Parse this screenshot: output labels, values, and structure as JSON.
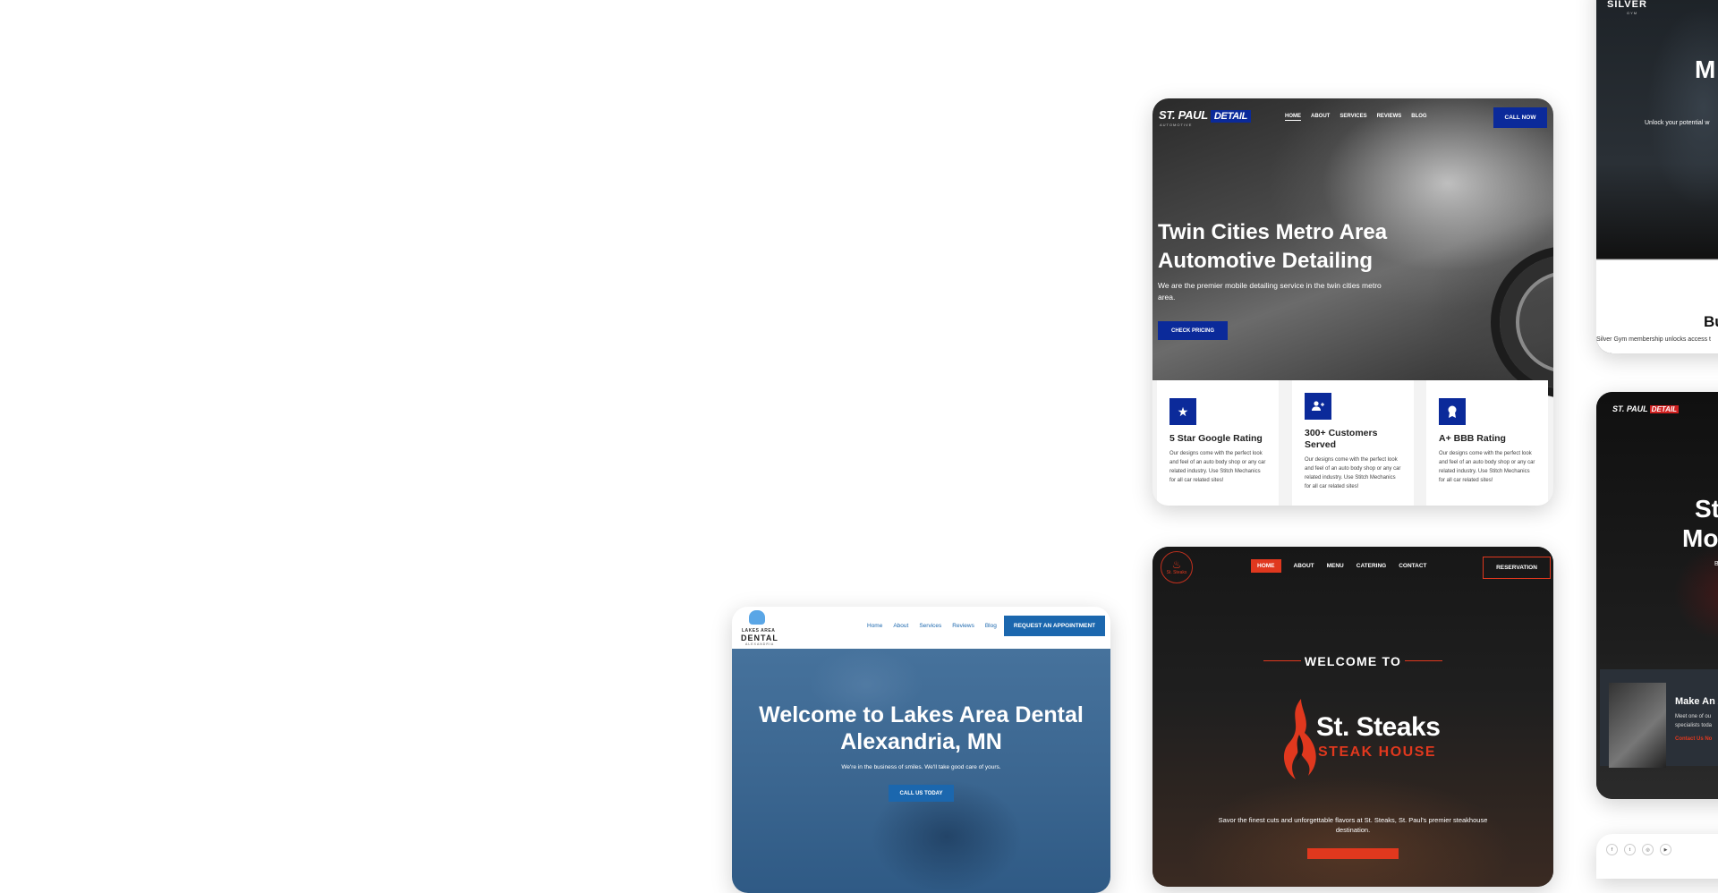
{
  "detail": {
    "logo_main": "ST. PAUL",
    "logo_badge": "DETAIL",
    "logo_sub": "AUTOMOTIVE",
    "nav": [
      "HOME",
      "ABOUT",
      "SERVICES",
      "REVIEWS",
      "BLOG"
    ],
    "call_button": "CALL NOW",
    "hero_title": "Twin Cities Metro Area Automotive Detailing",
    "hero_subtitle": "We are the premier mobile detailing service in the twin cities metro area.",
    "cta": "CHECK PRICING",
    "features": [
      {
        "icon": "star-icon",
        "title": "5 Star Google Rating",
        "desc": "Our designs come with the perfect look and feel of an auto body shop or any car related industry. Use Stitch Mechanics for all car related sites!"
      },
      {
        "icon": "user-plus-icon",
        "title": "300+ Customers Served",
        "desc": "Our designs come with the perfect look and feel of an auto body shop or any car related industry. Use Stitch Mechanics for all car related sites!"
      },
      {
        "icon": "award-icon",
        "title": "A+ BBB Rating",
        "desc": "Our designs come with the perfect look and feel of an auto body shop or any car related industry. Use Stitch Mechanics for all car related sites!"
      }
    ]
  },
  "steaks": {
    "emblem_name": "St. Steaks",
    "nav": [
      "HOME",
      "ABOUT",
      "MENU",
      "CATERING",
      "CONTACT"
    ],
    "reservation": "RESERVATION",
    "welcome": "WELCOME TO",
    "brand": "St. Steaks",
    "brand_sub": "STEAK HOUSE",
    "description": "Savor the finest cuts and unforgettable flavors at St. Steaks, St. Paul's premier steakhouse destination."
  },
  "dental": {
    "logo_line1": "LAKES AREA",
    "logo_line2": "DENTAL",
    "logo_line3": "ALEXANDRIA",
    "nav": [
      "Home",
      "About",
      "Services",
      "Reviews",
      "Blog"
    ],
    "appointment": "REQUEST AN APPOINTMENT",
    "hero_title": "Welcome to Lakes Area Dental Alexandria, MN",
    "hero_subtitle": "We're in the business of smiles. We'll take good care of yours.",
    "cta": "CALL US TODAY"
  },
  "gym": {
    "logo": "SILVER",
    "logo_sub": "GYM",
    "headline_fragment": "M",
    "tagline_fragment": "Unlock your potential w",
    "section_fragment": "Bu",
    "footer_fragment": "Silver Gym membership unlocks access t"
  },
  "detail2": {
    "logo_main": "ST. PAUL",
    "logo_badge": "DETAIL",
    "line1": "St",
    "line2": "Mo",
    "line3": "B",
    "panel_title": "Make An A",
    "panel_desc1": "Meet one of ou",
    "panel_desc2": "specialists toda",
    "panel_link": "Contact Us No"
  },
  "social": {
    "icons": [
      "facebook-icon",
      "twitter-icon",
      "instagram-icon",
      "youtube-icon"
    ],
    "glyphs": [
      "f",
      "t",
      "◎",
      "▶"
    ]
  },
  "colors": {
    "detail_blue": "#0b2a9a",
    "steak_red": "#e0381e",
    "dental_blue": "#1b67ae"
  }
}
